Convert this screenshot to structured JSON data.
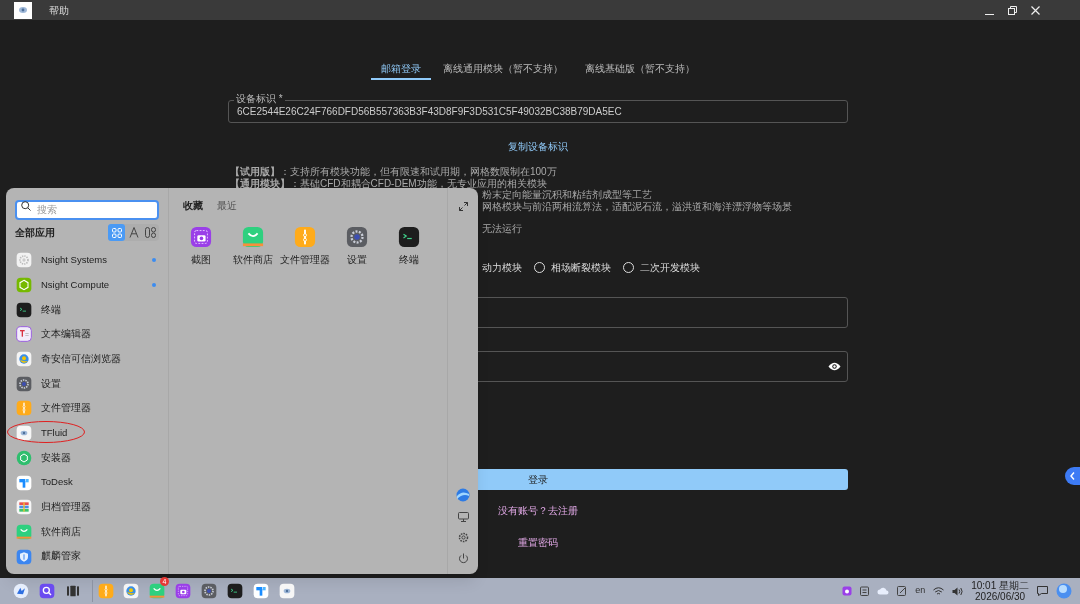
{
  "titlebar": {
    "menu": "帮助"
  },
  "tabs": [
    {
      "label": "邮箱登录",
      "selected": true
    },
    {
      "label": "离线通用模块（暂不支持）",
      "selected": false
    },
    {
      "label": "离线基础版（暂不支持）",
      "selected": false
    }
  ],
  "device_field": {
    "label": "设备标识 *",
    "value": "6CE2544E26C24F766DFD56B557363B3F43D8F9F3D531C5F49032BC38B79DA5EC"
  },
  "copy_link": "复制设备标识",
  "info_lines": [
    {
      "kind": "full",
      "text": "**【试用版】**：支持所有模块功能，但有限速和试用期，网格数限制在100万"
    },
    {
      "kind": "full",
      "text": "**【通用模块】**：基础CFD和耦合CFD-DEM功能，无专业应用的相关模块"
    },
    {
      "kind": "cut",
      "text": "粉末定向能量沉积和粘结剂成型等工艺"
    },
    {
      "kind": "cut",
      "text": "网格模块与前沿两相流算法，适配泥石流，溢洪道和海洋漂浮物等场景"
    },
    {
      "kind": "cut",
      "text": "无法运行"
    }
  ],
  "modules_cut_label": "动力模块",
  "modules": [
    {
      "label": "相场断裂模块",
      "selected": false
    },
    {
      "label": "二次开发模块",
      "selected": false
    }
  ],
  "login_button": "登录",
  "register_link": "没有账号？去注册",
  "reset_link": "重置密码",
  "start_menu": {
    "search": {
      "placeholder": "搜索"
    },
    "all_apps": "全部应用",
    "view_modes": [
      {
        "kind": "grid",
        "selected": true
      },
      {
        "kind": "letter",
        "selected": false
      },
      {
        "kind": "category",
        "selected": false
      }
    ],
    "apps": [
      {
        "kind": "nsight-systems",
        "label": "Nsight Systems",
        "new": true
      },
      {
        "kind": "nsight-compute",
        "label": "Nsight Compute",
        "new": true
      },
      {
        "kind": "terminal",
        "label": "终端",
        "new": false
      },
      {
        "kind": "editor",
        "label": "文本编辑器",
        "new": false
      },
      {
        "kind": "browser",
        "label": "奇安信可信浏览器",
        "new": false
      },
      {
        "kind": "settings",
        "label": "设置",
        "new": false
      },
      {
        "kind": "files",
        "label": "文件管理器",
        "new": false
      },
      {
        "kind": "tfluid",
        "label": "TFluid",
        "new": false
      },
      {
        "kind": "installer",
        "label": "安装器",
        "new": false
      },
      {
        "kind": "todesk",
        "label": "ToDesk",
        "new": false
      },
      {
        "kind": "archive",
        "label": "归档管理器",
        "new": false
      },
      {
        "kind": "store",
        "label": "软件商店",
        "new": false
      },
      {
        "kind": "manager",
        "label": "麒麟管家",
        "new": false
      }
    ],
    "tabs": [
      {
        "label": "收藏",
        "selected": true
      },
      {
        "label": "最近",
        "selected": false
      }
    ],
    "favorites": [
      {
        "kind": "screenshot",
        "label": "截图"
      },
      {
        "kind": "store",
        "label": "软件商店"
      },
      {
        "kind": "files",
        "label": "文件管理器"
      },
      {
        "kind": "settings",
        "label": "设置"
      },
      {
        "kind": "terminal",
        "label": "终端"
      }
    ]
  },
  "taskbar": {
    "apps": [
      {
        "kind": "launcher"
      },
      {
        "kind": "search"
      },
      {
        "kind": "multitask"
      },
      {
        "kind": "files"
      },
      {
        "kind": "browser"
      },
      {
        "kind": "store",
        "badge": "4"
      },
      {
        "kind": "screenshot"
      },
      {
        "kind": "settings"
      },
      {
        "kind": "terminal"
      },
      {
        "kind": "todesk"
      },
      {
        "kind": "tfluid"
      }
    ],
    "input_method": "en",
    "time": "10:01 星期二",
    "date": "2026/06/30"
  }
}
